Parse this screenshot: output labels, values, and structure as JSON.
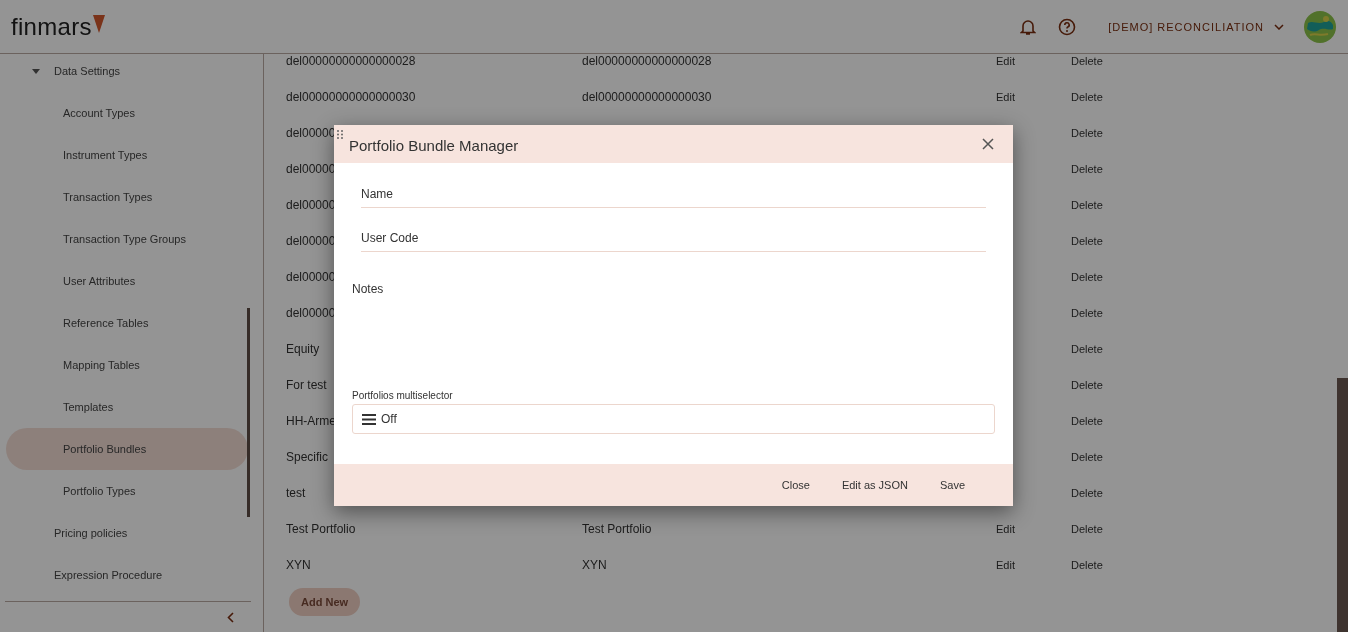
{
  "header": {
    "logo": "finmars",
    "workspace": "[DEMO] RECONCILIATION"
  },
  "sidebar": {
    "items": [
      {
        "label": "Data Settings",
        "expanded": true,
        "selected": false,
        "children": [
          {
            "label": "Account Types",
            "selected": false
          },
          {
            "label": "Instrument Types",
            "selected": false
          },
          {
            "label": "Transaction Types",
            "selected": false
          },
          {
            "label": "Transaction Type Groups",
            "selected": false
          },
          {
            "label": "User Attributes",
            "selected": false
          },
          {
            "label": "Reference Tables",
            "selected": false
          },
          {
            "label": "Mapping Tables",
            "selected": false
          },
          {
            "label": "Templates",
            "selected": false
          },
          {
            "label": "Portfolio Bundles",
            "selected": true
          },
          {
            "label": "Portfolio Types",
            "selected": false
          }
        ]
      },
      {
        "label": "Pricing policies",
        "selected": false
      },
      {
        "label": "Expression Procedure",
        "selected": false
      }
    ]
  },
  "table": {
    "rows": [
      {
        "name": "del00000000000000028",
        "user_code": "del00000000000000028",
        "edit": "Edit",
        "delete": "Delete"
      },
      {
        "name": "del00000000000000030",
        "user_code": "del00000000000000030",
        "edit": "Edit",
        "delete": "Delete"
      },
      {
        "name": "del00000",
        "delete": "Delete"
      },
      {
        "name": "del00000",
        "delete": "Delete"
      },
      {
        "name": "del00000",
        "delete": "Delete"
      },
      {
        "name": "del00000",
        "delete": "Delete"
      },
      {
        "name": "del00000",
        "delete": "Delete"
      },
      {
        "name": "del00000",
        "delete": "Delete"
      },
      {
        "name": "Equity",
        "delete": "Delete"
      },
      {
        "name": "For test",
        "delete": "Delete"
      },
      {
        "name": "HH-Arme",
        "delete": "Delete"
      },
      {
        "name": "Specific",
        "delete": "Delete"
      },
      {
        "name": "test",
        "delete": "Delete"
      },
      {
        "name": "Test Portfolio",
        "user_code": "Test Portfolio",
        "edit": "Edit",
        "delete": "Delete"
      },
      {
        "name": "XYN",
        "user_code": "XYN",
        "edit": "Edit",
        "delete": "Delete"
      }
    ],
    "add_button": "Add New"
  },
  "dialog": {
    "title": "Portfolio Bundle Manager",
    "fields": [
      {
        "label": "Name"
      },
      {
        "label": "User Code"
      }
    ],
    "notes_label": "Notes",
    "multiselector_label": "Portfolios multiselector",
    "multiselector_value": "Off",
    "buttons": [
      "Close",
      "Edit as JSON",
      "Save"
    ]
  }
}
